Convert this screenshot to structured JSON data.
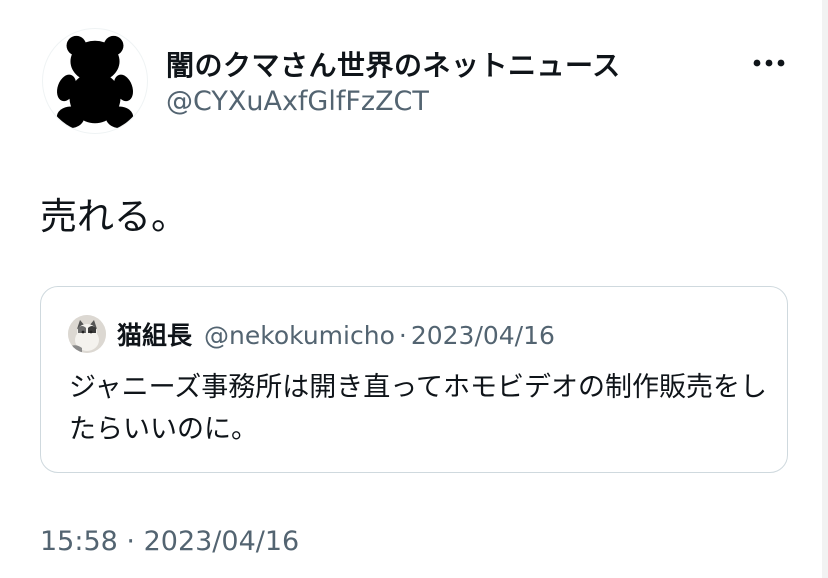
{
  "author": {
    "display_name": "闇のクマさん世界のネットニュース",
    "handle": "@CYXuAxfGlfFzZCT",
    "avatar_icon": "bear-silhouette-icon"
  },
  "tweet": {
    "text": "売れる。"
  },
  "quoted_tweet": {
    "display_name": "猫組長",
    "handle": "@nekokumicho",
    "separator": "·",
    "date": "2023/04/16",
    "text": "ジャニーズ事務所は開き直ってホモビデオの制作販売をしたらいいのに。",
    "avatar_icon": "cat-photo-icon"
  },
  "timestamp": {
    "time": "15:58",
    "separator": "·",
    "date": "2023/04/16"
  },
  "more_icon": "more-horizontal-icon",
  "colors": {
    "text_primary": "#0f1419",
    "text_secondary": "#536471",
    "border": "#cfd9de"
  }
}
